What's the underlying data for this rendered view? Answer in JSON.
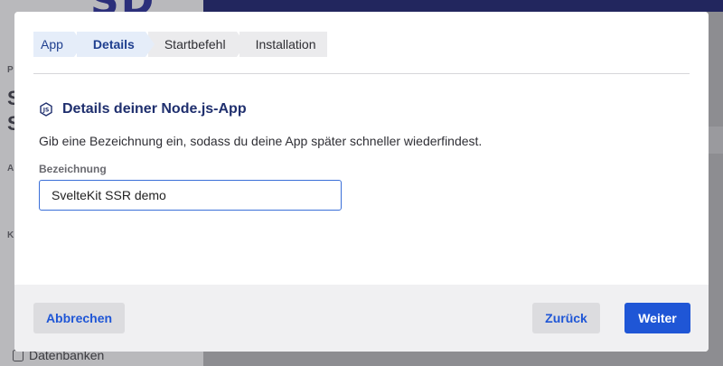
{
  "background": {
    "logo_text": "SD",
    "sidebar_letters": [
      "P",
      "S",
      "S",
      "A",
      "K"
    ],
    "bottom_item": "Datenbanken"
  },
  "wizard": {
    "steps": [
      {
        "label": "App"
      },
      {
        "label": "Details"
      },
      {
        "label": "Startbefehl"
      },
      {
        "label": "Installation"
      }
    ],
    "active_step": "Details",
    "heading": "Details deiner Node.js-App",
    "description": "Gib eine Bezeichnung ein, sodass du deine App später schneller wiederfindest.",
    "field_label": "Bezeichnung",
    "field_value": "SvelteKit SSR demo",
    "buttons": {
      "cancel": "Abbrechen",
      "back": "Zurück",
      "next": "Weiter"
    }
  },
  "colors": {
    "accent": "#1f56d6",
    "heading": "#1f2f6e",
    "active_step_bg": "#e5edf9"
  },
  "icons": {
    "heading_icon": "nodejs-icon",
    "database_icon": "database-icon"
  }
}
